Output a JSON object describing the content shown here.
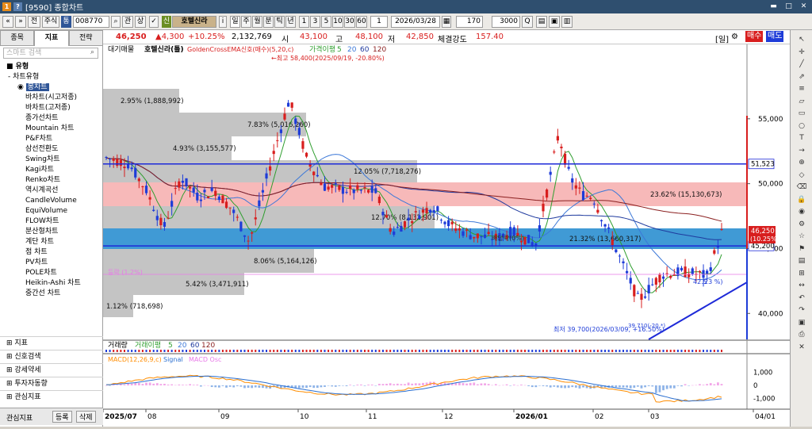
{
  "window": {
    "title": "[9590] 종합차트",
    "icon_a": "1",
    "icon_b": "?",
    "controls": [
      "▬",
      "□",
      "✕"
    ]
  },
  "toolbar": {
    "nav_prev": "«",
    "nav_next": "»",
    "jeon": "전",
    "stock_btn": "주식",
    "kind_badge": "통",
    "code": "008770",
    "search_glyph": "⌕",
    "gwan": "관",
    "sang": "상",
    "checked_badge": "신",
    "stock_name": "호텔신라",
    "info": "i",
    "periods": [
      "일",
      "주",
      "월",
      "분",
      "틱",
      "년"
    ],
    "intervals": [
      "1",
      "3",
      "5",
      "10",
      "30",
      "60"
    ],
    "count_1": "1",
    "date": "2026/03/28",
    "n1": "170",
    "n2": "3000",
    "q_glyph": "Q"
  },
  "quote": {
    "price": "46,250",
    "change": "▲4,300",
    "pct": "+10.25%",
    "volume": "2,132,769",
    "open_lbl": "시",
    "open": "43,100",
    "high_lbl": "고",
    "high": "48,100",
    "low_lbl": "저",
    "low": "42,850",
    "strength_lbl": "체결강도",
    "strength": "157.40",
    "il_btn": "[일]",
    "buy": "매수",
    "sell": "매도"
  },
  "sidebar": {
    "tabs": [
      "종목",
      "지표",
      "전략"
    ],
    "search_placeholder": "스마트 검색",
    "section": "유형",
    "group": "차트유형",
    "items": [
      "봉차트",
      "바차트(시고저종)",
      "바차트(고저종)",
      "종가선차트",
      "Mountain 차트",
      "P&F차트",
      "삼선전환도",
      "Swing차트",
      "Kagi차트",
      "Renko차트",
      "역시계곡선",
      "CandleVolume",
      "EquiVolume",
      "FLOW차트",
      "분산형차트",
      "계단 차트",
      "점 차트",
      "PV차트",
      "POLE차트",
      "Heikin-Ashi 차트",
      "중간선 차트"
    ],
    "bottom": [
      "지표",
      "신호검색",
      "강세약세",
      "투자자동향",
      "관심지표"
    ],
    "footer_label": "관심지표",
    "footer_add": "등록",
    "footer_del": "삭제"
  },
  "legend": {
    "main": "대기매물",
    "name": "호텔신라(틀)",
    "signal": "GoldenCrossEMA신호(매수)(5,20,c)",
    "ma_label": "가격이평",
    "ma": [
      "5",
      "20",
      "60",
      "120"
    ],
    "vol_label": "거래량",
    "vol_ma_label": "거래이평",
    "vol_ma": [
      "5",
      "20",
      "60",
      "120"
    ],
    "macd": "MACD(12,26,9,c)",
    "macd_signal": "Signal",
    "macd_osc": "MACD Osc"
  },
  "annotations": {
    "high_note": "←최고 58,400(2025/09/19, -20.80%)",
    "low_note": "최저 39,700(2026/03/09, +16.50%)",
    "low2": "39,710(-20.*)",
    "dividend": "배당락(0%)",
    "mid1": "23.62% (15,130,673)",
    "mid2": "42.5",
    "mid3": "23 %)",
    "pink": "등락 (1.2%)"
  },
  "chart_data": {
    "type": "candlestick",
    "y_axis": {
      "min": 38000,
      "max": 60000,
      "ticks": [
        "55,000",
        "50,000",
        "45,000",
        "40,000"
      ],
      "tick_values": [
        55000,
        50000,
        45000,
        40000
      ]
    },
    "x_labels": [
      "2025/07",
      "08",
      "09",
      "10",
      "11",
      "12",
      "2026/01",
      "02",
      "03",
      "04/01"
    ],
    "price_labels": {
      "top_line": "51,523",
      "top_value": 51523,
      "bottom_line": "45,200",
      "bottom_value": 45200,
      "current": "46,250",
      "current_pct": "(10.25%)",
      "current_value": 46250
    },
    "volume_profile": [
      {
        "label": "2.95% (1,888,992)",
        "value": 1888992,
        "level": 56000
      },
      {
        "label": "7.83% (5,016,260)",
        "value": 5016260,
        "level": 53800
      },
      {
        "label": "4.93% (3,155,577)",
        "value": 3155577,
        "level": 52200
      },
      {
        "label": "12.05% (7,718,276)",
        "value": 7718276,
        "level": 50600
      },
      {
        "label": "23.62% (15,130,673)",
        "value": 15130673,
        "level": 49000
      },
      {
        "label": "12.70% (8,132,901)",
        "value": 8132901,
        "level": 47400
      },
      {
        "label": "21.32% (13,660,317)",
        "value": 13660317,
        "level": 45800
      },
      {
        "label": "8.06% (5,164,126)",
        "value": 5164126,
        "level": 44200
      },
      {
        "label": "5.42% (3,471,911)",
        "value": 3471911,
        "level": 42600
      },
      {
        "label": "1.12% (718,698)",
        "value": 718698,
        "level": 41000
      }
    ],
    "macd_axis": {
      "ticks": [
        "1,000",
        "0",
        "-1,000"
      ],
      "values": [
        1000,
        0,
        -1000
      ]
    },
    "colors": {
      "up": "#d81e1e",
      "down": "#1e3cd8",
      "ma5": "#2f9e2f",
      "ma20": "#3c78d8",
      "ma60": "#1f3a9e",
      "ma120": "#8b2020",
      "box_pink": "#f08080",
      "box_blue": "#2b8fd0",
      "box_gray": "#b0b0b0",
      "macd": "#ff8c00",
      "signal": "#2b6fd0",
      "osc": "#e879e8"
    }
  }
}
